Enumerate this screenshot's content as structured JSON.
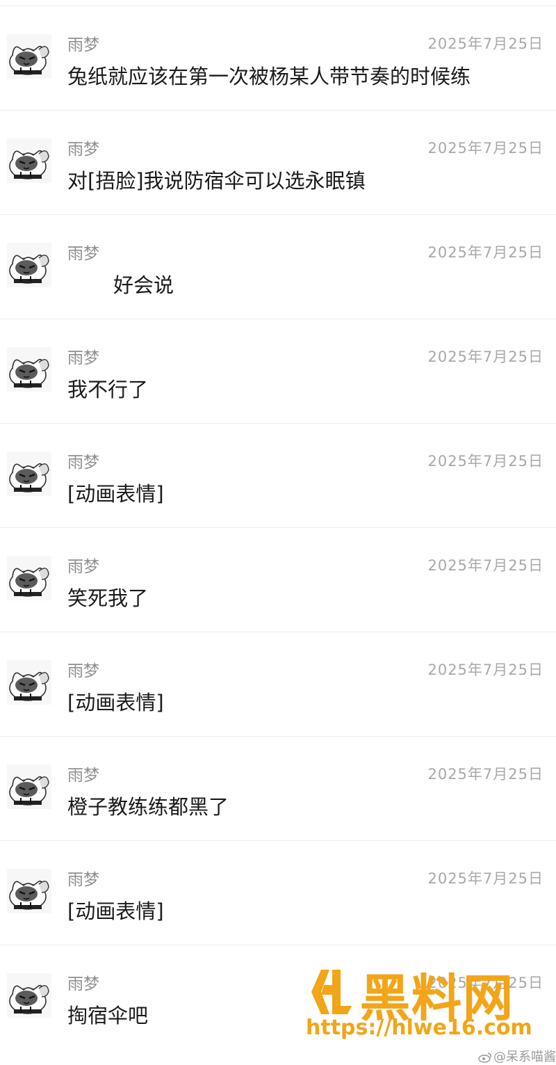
{
  "messages": [
    {
      "name": "雨梦",
      "date": "2025年7月25日",
      "text": "兔纸就应该在第一次被杨某人带节奏的时候练"
    },
    {
      "name": "雨梦",
      "date": "2025年7月25日",
      "text": "对[捂脸]我说防宿伞可以选永眠镇"
    },
    {
      "name": "雨梦",
      "date": "2025年7月25日",
      "text": "好会说"
    },
    {
      "name": "雨梦",
      "date": "2025年7月25日",
      "text": "我不行了"
    },
    {
      "name": "雨梦",
      "date": "2025年7月25日",
      "text": "[动画表情]"
    },
    {
      "name": "雨梦",
      "date": "2025年7月25日",
      "text": "笑死我了"
    },
    {
      "name": "雨梦",
      "date": "2025年7月25日",
      "text": "[动画表情]"
    },
    {
      "name": "雨梦",
      "date": "2025年7月25日",
      "text": "橙子教练练都黑了"
    },
    {
      "name": "雨梦",
      "date": "2025年7月25日",
      "text": "[动画表情]"
    },
    {
      "name": "雨梦",
      "date": "2025年7月25日",
      "text": "掏宿伞吧"
    }
  ],
  "watermark": {
    "title": "黑料网",
    "url": "https://hlwe16.com",
    "color": "#f2a516"
  },
  "credit": "@呆系喵酱",
  "icons": {
    "avatar": "cat-avatar-icon",
    "logo": "hl-logo-icon",
    "weibo": "weibo-icon"
  }
}
